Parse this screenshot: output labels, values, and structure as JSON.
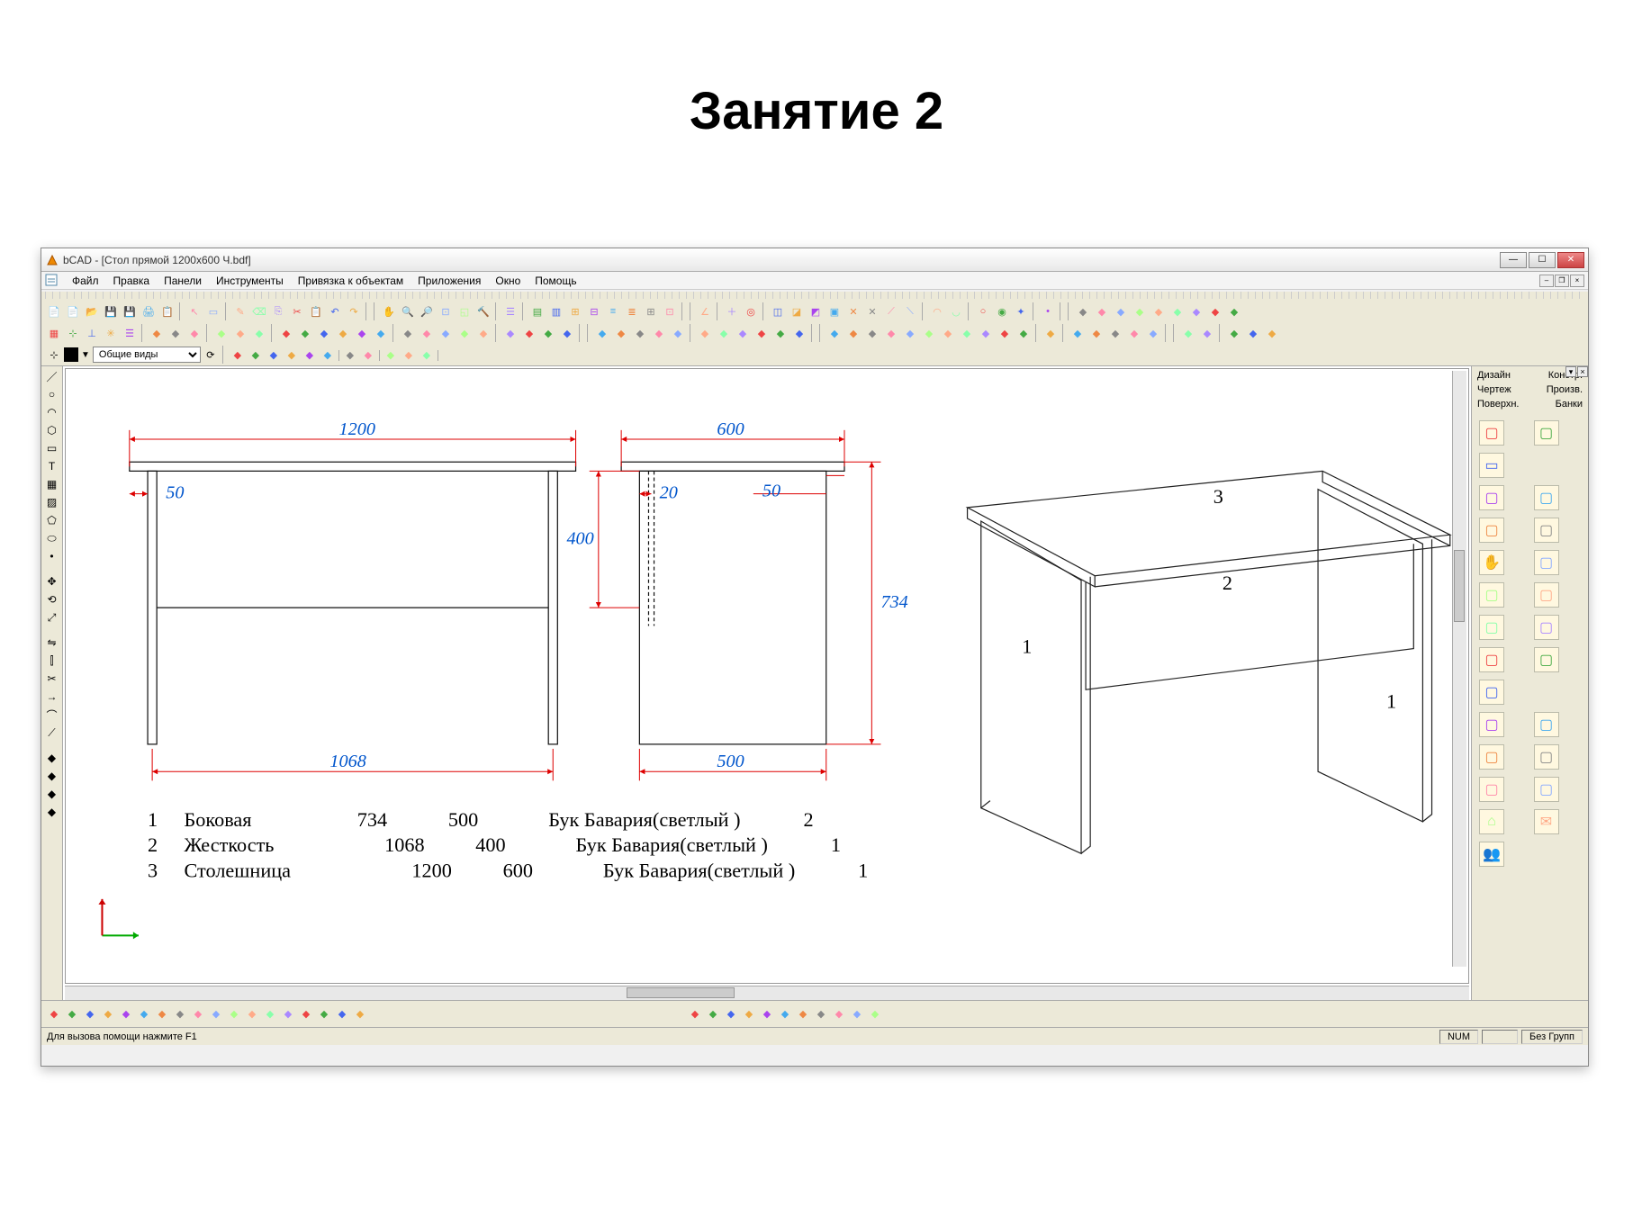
{
  "page_title": "Занятие 2",
  "window": {
    "title": "bCAD - [Стол прямой 1200x600 Ч.bdf]"
  },
  "menu": [
    "Файл",
    "Правка",
    "Панели",
    "Инструменты",
    "Привязка к объектам",
    "Приложения",
    "Окно",
    "Помощь"
  ],
  "view_selector": "Общие виды",
  "right_panel": {
    "tabs": [
      [
        "Дизайн",
        "Констр."
      ],
      [
        "Чертеж",
        "Произв."
      ],
      [
        "Поверхн.",
        "Банки"
      ]
    ]
  },
  "statusbar": {
    "hint": "Для вызова помощи нажмите F1",
    "num": "NUM",
    "group": "Без Групп"
  },
  "drawing": {
    "dims": {
      "top_width": "1200",
      "side_width": "600",
      "leg_offset_front": "50",
      "leg_offset_side_in": "20",
      "leg_offset_side_out": "50",
      "apron_height": "400",
      "total_height": "734",
      "inner_width": "1068",
      "side_bottom": "500"
    },
    "iso_labels": {
      "p1": "1",
      "p2": "2",
      "p3": "3",
      "p1b": "1"
    },
    "parts": [
      {
        "n": "1",
        "name": "Боковая",
        "d1": "734",
        "d2": "500",
        "mat": "Бук Бавария(светлый )",
        "qty": "2"
      },
      {
        "n": "2",
        "name": "Жесткость",
        "d1": "1068",
        "d2": "400",
        "mat": "Бук Бавария(светлый )",
        "qty": "1"
      },
      {
        "n": "3",
        "name": "Столешница",
        "d1": "1200",
        "d2": "600",
        "mat": "Бук Бавария(светлый )",
        "qty": "1"
      }
    ]
  },
  "icons": {
    "tb_row1": [
      "new",
      "new2",
      "open",
      "save",
      "saveall",
      "print",
      "props",
      "sep",
      "cursor",
      "select",
      "sep",
      "pencil",
      "eraser",
      "copy",
      "scissors",
      "paste",
      "undo",
      "redo",
      "sep",
      "sep",
      "hand",
      "zoom-in",
      "zoom-out",
      "zoom-fit",
      "zoom-window",
      "hammer",
      "sep",
      "layers",
      "sep",
      "front",
      "back",
      "group",
      "ungroup",
      "align1",
      "align2",
      "grid1",
      "grid2",
      "sep",
      "sep",
      "angle",
      "sep",
      "plus",
      "target",
      "sep",
      "clip1",
      "clip2",
      "clip3",
      "clip4",
      "cut1",
      "cut2",
      "cut3",
      "cut4",
      "sep",
      "arc1",
      "arc2",
      "sep",
      "circle1",
      "circle2",
      "star",
      "sep",
      "dot",
      "sep",
      "sep",
      "m1",
      "m2",
      "m3",
      "m4",
      "m5",
      "m6",
      "m7",
      "m8",
      "m9"
    ],
    "tb_row2": [
      "grid",
      "snap",
      "ortho",
      "polar",
      "layer-btn",
      "sep",
      "la1",
      "la2",
      "la3",
      "sep",
      "zoom1",
      "zoom2",
      "zoom3",
      "sep",
      "v1",
      "v2",
      "v3",
      "v4",
      "v5",
      "v6",
      "sep",
      "r1",
      "r2",
      "r3",
      "r4",
      "r5",
      "sep",
      "h1",
      "h2",
      "h3",
      "h4",
      "sep",
      "sep",
      "d1",
      "d2",
      "d3",
      "d4",
      "d5",
      "sep",
      "g1",
      "g2",
      "g3",
      "g4",
      "g5",
      "dots",
      "sep",
      "sep",
      "s1",
      "s2",
      "s3",
      "s4",
      "s5",
      "s6",
      "s7",
      "s8",
      "s9",
      "s10",
      "s11",
      "sep",
      "b1",
      "sep",
      "c1",
      "c2",
      "c3",
      "c4",
      "c5",
      "sep",
      "sep",
      "paint",
      "light",
      "sep",
      "win",
      "render",
      "print2"
    ],
    "tb_row3": [
      "snap1",
      "color",
      "sep",
      "sel",
      "sep",
      "dd",
      "sep",
      "vp1",
      "vp2",
      "vp3",
      "vp4",
      "vp5",
      "vp6",
      "sep",
      "vv1",
      "vv2",
      "sep",
      "mm1",
      "mm2",
      "mm3",
      "sep"
    ],
    "left": [
      "line",
      "circle",
      "arc",
      "poly",
      "rect",
      "text",
      "hatch",
      "region",
      "polygon",
      "ellipse",
      "point",
      "sep",
      "move",
      "rotate-l",
      "scale-l",
      "sep",
      "mirror",
      "offset",
      "trim",
      "extend",
      "fillet",
      "chamfer",
      "sep",
      "dim1",
      "dim2",
      "dim3",
      "dim4"
    ],
    "bottom_left": [
      "sh1",
      "sh2",
      "sh3",
      "sh4",
      "sh5",
      "sh6",
      "sh7",
      "sh8",
      "sh9",
      "sh10",
      "sh11",
      "sh12",
      "sh13",
      "sh14",
      "sh15",
      "sh16",
      "sh17",
      "sh18"
    ],
    "bottom_right": [
      "br1",
      "br2",
      "br3",
      "br4",
      "br5",
      "br6",
      "br7",
      "br8",
      "br9",
      "br10",
      "br11"
    ],
    "rp_icons": [
      "panel",
      "lshape",
      "rect",
      "",
      "box",
      "boxopen",
      "extrude1",
      "extrude2",
      "hand",
      "tool",
      "block",
      "list",
      "col1",
      "col2",
      "mat1",
      "mat2",
      "tex",
      "",
      "t1",
      "t2",
      "del1",
      "del2",
      "spl1",
      "spl2",
      "home",
      "mail",
      "people"
    ]
  }
}
